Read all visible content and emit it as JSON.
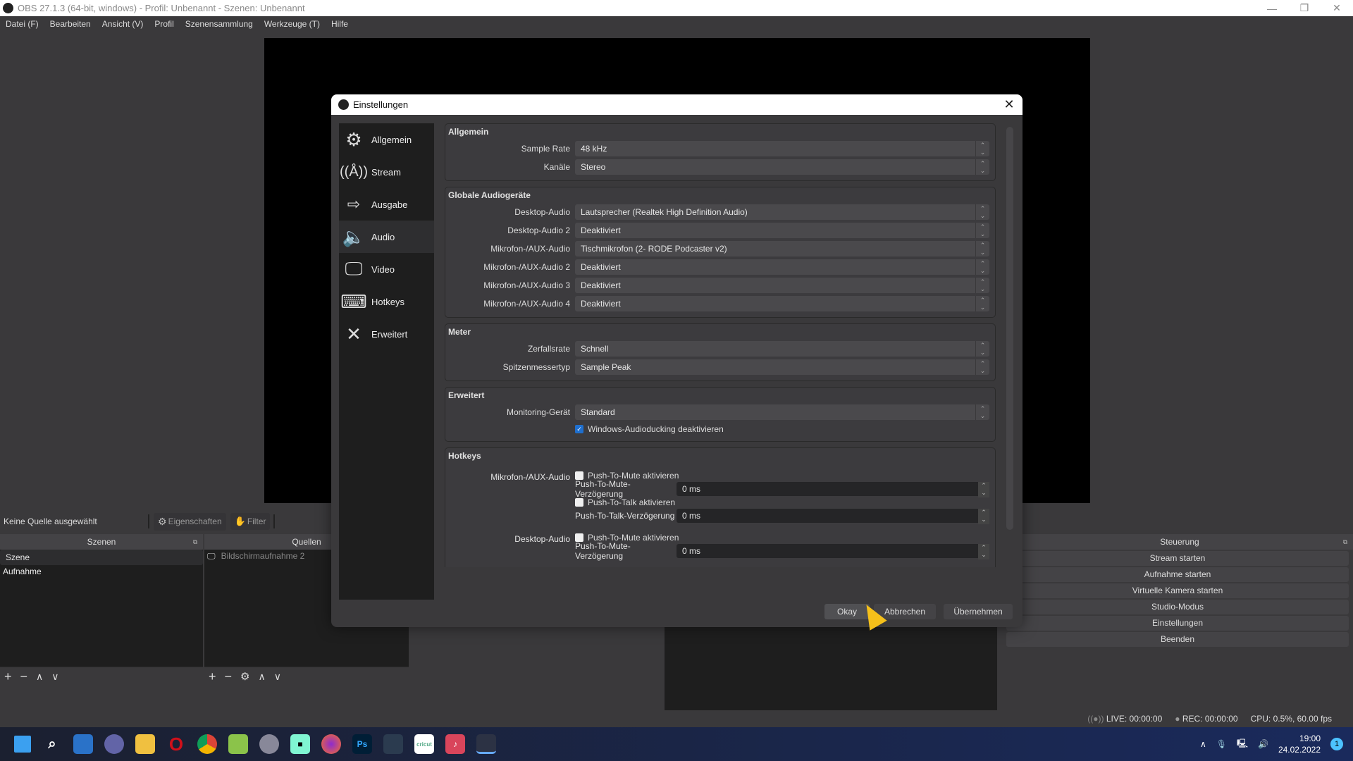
{
  "window": {
    "title": "OBS 27.1.3 (64-bit, windows) - Profil: Unbenannt - Szenen: Unbenannt"
  },
  "menu": [
    "Datei (F)",
    "Bearbeiten",
    "Ansicht (V)",
    "Profil",
    "Szenensammlung",
    "Werkzeuge (T)",
    "Hilfe"
  ],
  "source_toolbar": {
    "no_source": "Keine Quelle ausgewählt",
    "properties": "Eigenschaften",
    "filter": "Filter"
  },
  "scenes": {
    "header": "Szenen",
    "items": [
      "Szene",
      "Aufnahme"
    ]
  },
  "sources": {
    "header": "Quellen",
    "items": [
      "Bildschirmaufnahme 2"
    ]
  },
  "controls": {
    "header": "Steuerung",
    "buttons": [
      "Stream starten",
      "Aufnahme starten",
      "Virtuelle Kamera starten",
      "Studio-Modus",
      "Einstellungen",
      "Beenden"
    ]
  },
  "status": {
    "live": "LIVE: 00:00:00",
    "rec": "REC: 00:00:00",
    "cpu": "CPU: 0.5%, 60.00 fps"
  },
  "tray": {
    "time": "19:00",
    "date": "24.02.2022",
    "notifications": "1"
  },
  "taskbar": {
    "ps_label": "Ps",
    "cricut_label": "cricut"
  },
  "dialog": {
    "title": "Einstellungen",
    "nav": [
      {
        "label": "Allgemein",
        "icon": "gear"
      },
      {
        "label": "Stream",
        "icon": "antenna"
      },
      {
        "label": "Ausgabe",
        "icon": "output"
      },
      {
        "label": "Audio",
        "icon": "speaker"
      },
      {
        "label": "Video",
        "icon": "monitor"
      },
      {
        "label": "Hotkeys",
        "icon": "keyboard"
      },
      {
        "label": "Erweitert",
        "icon": "tools"
      }
    ],
    "groups": {
      "general": {
        "title": "Allgemein",
        "rows": [
          {
            "label": "Sample Rate",
            "value": "48 kHz"
          },
          {
            "label": "Kanäle",
            "value": "Stereo"
          }
        ]
      },
      "devices": {
        "title": "Globale Audiogeräte",
        "rows": [
          {
            "label": "Desktop-Audio",
            "value": "Lautsprecher (Realtek High Definition Audio)"
          },
          {
            "label": "Desktop-Audio 2",
            "value": "Deaktiviert"
          },
          {
            "label": "Mikrofon-/AUX-Audio",
            "value": "Tischmikrofon (2- RODE Podcaster v2)"
          },
          {
            "label": "Mikrofon-/AUX-Audio 2",
            "value": "Deaktiviert"
          },
          {
            "label": "Mikrofon-/AUX-Audio 3",
            "value": "Deaktiviert"
          },
          {
            "label": "Mikrofon-/AUX-Audio 4",
            "value": "Deaktiviert"
          }
        ]
      },
      "meter": {
        "title": "Meter",
        "rows": [
          {
            "label": "Zerfallsrate",
            "value": "Schnell"
          },
          {
            "label": "Spitzenmessertyp",
            "value": "Sample Peak"
          }
        ]
      },
      "advanced": {
        "title": "Erweitert",
        "monitoring_label": "Monitoring-Gerät",
        "monitoring_value": "Standard",
        "ducking_label": "Windows-Audioducking deaktivieren",
        "ducking_checked": true
      },
      "hotkeys": {
        "title": "Hotkeys",
        "mic_label": "Mikrofon-/AUX-Audio",
        "desktop_label": "Desktop-Audio",
        "ptm_enable": "Push-To-Mute aktivieren",
        "ptm_delay": "Push-To-Mute-Verzögerung",
        "ptt_enable": "Push-To-Talk aktivieren",
        "ptt_delay": "Push-To-Talk-Verzögerung",
        "delay_value": "0 ms"
      }
    },
    "buttons": {
      "ok": "Okay",
      "cancel": "Abbrechen",
      "apply": "Übernehmen"
    }
  }
}
